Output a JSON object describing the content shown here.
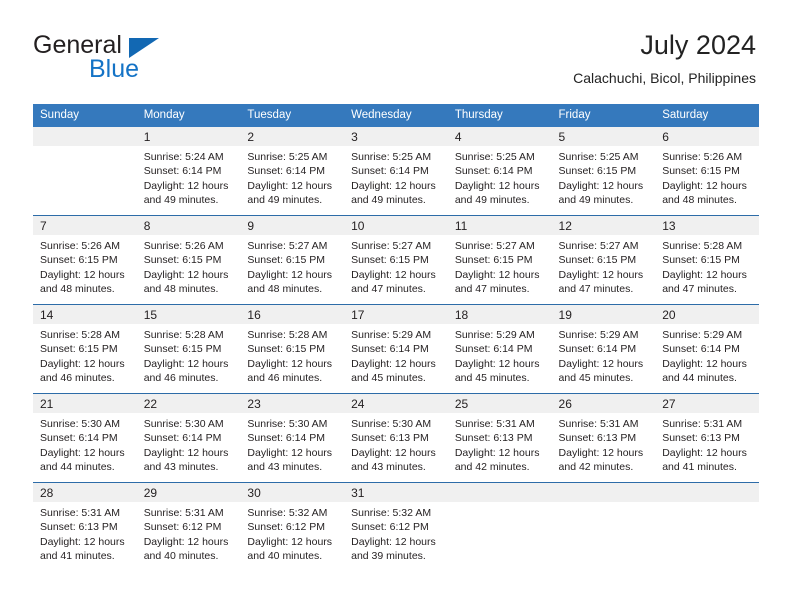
{
  "brand": {
    "name_part1": "General",
    "name_part2": "Blue",
    "flag_icon": "triangle-flag-icon",
    "accent_color": "#1473c6"
  },
  "header": {
    "title": "July 2024",
    "subtitle": "Calachuchi, Bicol, Philippines"
  },
  "colors": {
    "header_row_bg": "#3579bd",
    "daynum_strip_bg": "#f0f0f0",
    "week_separator": "#2d6ca8",
    "text": "#231f20"
  },
  "weekday_headers": [
    "Sunday",
    "Monday",
    "Tuesday",
    "Wednesday",
    "Thursday",
    "Friday",
    "Saturday"
  ],
  "weeks": [
    [
      {
        "day": "",
        "sunrise": "",
        "sunset": "",
        "daylight_line1": "",
        "daylight_line2": ""
      },
      {
        "day": "1",
        "sunrise": "Sunrise: 5:24 AM",
        "sunset": "Sunset: 6:14 PM",
        "daylight_line1": "Daylight: 12 hours",
        "daylight_line2": "and 49 minutes."
      },
      {
        "day": "2",
        "sunrise": "Sunrise: 5:25 AM",
        "sunset": "Sunset: 6:14 PM",
        "daylight_line1": "Daylight: 12 hours",
        "daylight_line2": "and 49 minutes."
      },
      {
        "day": "3",
        "sunrise": "Sunrise: 5:25 AM",
        "sunset": "Sunset: 6:14 PM",
        "daylight_line1": "Daylight: 12 hours",
        "daylight_line2": "and 49 minutes."
      },
      {
        "day": "4",
        "sunrise": "Sunrise: 5:25 AM",
        "sunset": "Sunset: 6:14 PM",
        "daylight_line1": "Daylight: 12 hours",
        "daylight_line2": "and 49 minutes."
      },
      {
        "day": "5",
        "sunrise": "Sunrise: 5:25 AM",
        "sunset": "Sunset: 6:15 PM",
        "daylight_line1": "Daylight: 12 hours",
        "daylight_line2": "and 49 minutes."
      },
      {
        "day": "6",
        "sunrise": "Sunrise: 5:26 AM",
        "sunset": "Sunset: 6:15 PM",
        "daylight_line1": "Daylight: 12 hours",
        "daylight_line2": "and 48 minutes."
      }
    ],
    [
      {
        "day": "7",
        "sunrise": "Sunrise: 5:26 AM",
        "sunset": "Sunset: 6:15 PM",
        "daylight_line1": "Daylight: 12 hours",
        "daylight_line2": "and 48 minutes."
      },
      {
        "day": "8",
        "sunrise": "Sunrise: 5:26 AM",
        "sunset": "Sunset: 6:15 PM",
        "daylight_line1": "Daylight: 12 hours",
        "daylight_line2": "and 48 minutes."
      },
      {
        "day": "9",
        "sunrise": "Sunrise: 5:27 AM",
        "sunset": "Sunset: 6:15 PM",
        "daylight_line1": "Daylight: 12 hours",
        "daylight_line2": "and 48 minutes."
      },
      {
        "day": "10",
        "sunrise": "Sunrise: 5:27 AM",
        "sunset": "Sunset: 6:15 PM",
        "daylight_line1": "Daylight: 12 hours",
        "daylight_line2": "and 47 minutes."
      },
      {
        "day": "11",
        "sunrise": "Sunrise: 5:27 AM",
        "sunset": "Sunset: 6:15 PM",
        "daylight_line1": "Daylight: 12 hours",
        "daylight_line2": "and 47 minutes."
      },
      {
        "day": "12",
        "sunrise": "Sunrise: 5:27 AM",
        "sunset": "Sunset: 6:15 PM",
        "daylight_line1": "Daylight: 12 hours",
        "daylight_line2": "and 47 minutes."
      },
      {
        "day": "13",
        "sunrise": "Sunrise: 5:28 AM",
        "sunset": "Sunset: 6:15 PM",
        "daylight_line1": "Daylight: 12 hours",
        "daylight_line2": "and 47 minutes."
      }
    ],
    [
      {
        "day": "14",
        "sunrise": "Sunrise: 5:28 AM",
        "sunset": "Sunset: 6:15 PM",
        "daylight_line1": "Daylight: 12 hours",
        "daylight_line2": "and 46 minutes."
      },
      {
        "day": "15",
        "sunrise": "Sunrise: 5:28 AM",
        "sunset": "Sunset: 6:15 PM",
        "daylight_line1": "Daylight: 12 hours",
        "daylight_line2": "and 46 minutes."
      },
      {
        "day": "16",
        "sunrise": "Sunrise: 5:28 AM",
        "sunset": "Sunset: 6:15 PM",
        "daylight_line1": "Daylight: 12 hours",
        "daylight_line2": "and 46 minutes."
      },
      {
        "day": "17",
        "sunrise": "Sunrise: 5:29 AM",
        "sunset": "Sunset: 6:14 PM",
        "daylight_line1": "Daylight: 12 hours",
        "daylight_line2": "and 45 minutes."
      },
      {
        "day": "18",
        "sunrise": "Sunrise: 5:29 AM",
        "sunset": "Sunset: 6:14 PM",
        "daylight_line1": "Daylight: 12 hours",
        "daylight_line2": "and 45 minutes."
      },
      {
        "day": "19",
        "sunrise": "Sunrise: 5:29 AM",
        "sunset": "Sunset: 6:14 PM",
        "daylight_line1": "Daylight: 12 hours",
        "daylight_line2": "and 45 minutes."
      },
      {
        "day": "20",
        "sunrise": "Sunrise: 5:29 AM",
        "sunset": "Sunset: 6:14 PM",
        "daylight_line1": "Daylight: 12 hours",
        "daylight_line2": "and 44 minutes."
      }
    ],
    [
      {
        "day": "21",
        "sunrise": "Sunrise: 5:30 AM",
        "sunset": "Sunset: 6:14 PM",
        "daylight_line1": "Daylight: 12 hours",
        "daylight_line2": "and 44 minutes."
      },
      {
        "day": "22",
        "sunrise": "Sunrise: 5:30 AM",
        "sunset": "Sunset: 6:14 PM",
        "daylight_line1": "Daylight: 12 hours",
        "daylight_line2": "and 43 minutes."
      },
      {
        "day": "23",
        "sunrise": "Sunrise: 5:30 AM",
        "sunset": "Sunset: 6:14 PM",
        "daylight_line1": "Daylight: 12 hours",
        "daylight_line2": "and 43 minutes."
      },
      {
        "day": "24",
        "sunrise": "Sunrise: 5:30 AM",
        "sunset": "Sunset: 6:13 PM",
        "daylight_line1": "Daylight: 12 hours",
        "daylight_line2": "and 43 minutes."
      },
      {
        "day": "25",
        "sunrise": "Sunrise: 5:31 AM",
        "sunset": "Sunset: 6:13 PM",
        "daylight_line1": "Daylight: 12 hours",
        "daylight_line2": "and 42 minutes."
      },
      {
        "day": "26",
        "sunrise": "Sunrise: 5:31 AM",
        "sunset": "Sunset: 6:13 PM",
        "daylight_line1": "Daylight: 12 hours",
        "daylight_line2": "and 42 minutes."
      },
      {
        "day": "27",
        "sunrise": "Sunrise: 5:31 AM",
        "sunset": "Sunset: 6:13 PM",
        "daylight_line1": "Daylight: 12 hours",
        "daylight_line2": "and 41 minutes."
      }
    ],
    [
      {
        "day": "28",
        "sunrise": "Sunrise: 5:31 AM",
        "sunset": "Sunset: 6:13 PM",
        "daylight_line1": "Daylight: 12 hours",
        "daylight_line2": "and 41 minutes."
      },
      {
        "day": "29",
        "sunrise": "Sunrise: 5:31 AM",
        "sunset": "Sunset: 6:12 PM",
        "daylight_line1": "Daylight: 12 hours",
        "daylight_line2": "and 40 minutes."
      },
      {
        "day": "30",
        "sunrise": "Sunrise: 5:32 AM",
        "sunset": "Sunset: 6:12 PM",
        "daylight_line1": "Daylight: 12 hours",
        "daylight_line2": "and 40 minutes."
      },
      {
        "day": "31",
        "sunrise": "Sunrise: 5:32 AM",
        "sunset": "Sunset: 6:12 PM",
        "daylight_line1": "Daylight: 12 hours",
        "daylight_line2": "and 39 minutes."
      },
      {
        "day": "",
        "sunrise": "",
        "sunset": "",
        "daylight_line1": "",
        "daylight_line2": ""
      },
      {
        "day": "",
        "sunrise": "",
        "sunset": "",
        "daylight_line1": "",
        "daylight_line2": ""
      },
      {
        "day": "",
        "sunrise": "",
        "sunset": "",
        "daylight_line1": "",
        "daylight_line2": ""
      }
    ]
  ]
}
